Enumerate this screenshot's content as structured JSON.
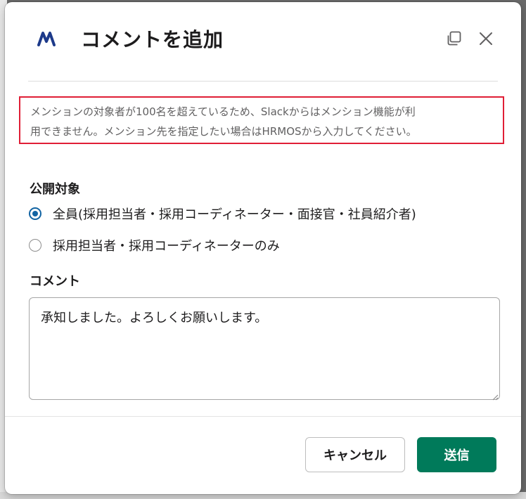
{
  "modal": {
    "title": "コメントを追加",
    "logo_icon": "hrmos-logo-icon",
    "popout_icon": "popout-window-icon",
    "close_icon": "close-icon"
  },
  "notice": {
    "line1": "メンションの対象者が100名を超えているため、Slackからはメンション機能が利",
    "line2": "用できません。メンション先を指定したい場合はHRMOSから入力してください。",
    "border_color": "#e01e36"
  },
  "visibility": {
    "label": "公開対象",
    "options": [
      {
        "label": "全員(採用担当者・採用コーディネーター・面接官・社員紹介者)",
        "selected": true
      },
      {
        "label": "採用担当者・採用コーディネーターのみ",
        "selected": false
      }
    ]
  },
  "comment": {
    "label": "コメント",
    "value": "承知しました。よろしくお願いします。"
  },
  "footer": {
    "cancel_label": "キャンセル",
    "send_label": "送信"
  },
  "colors": {
    "accent": "#1264a3",
    "send_button": "#007a5a",
    "logo": "#1d3a8a"
  }
}
